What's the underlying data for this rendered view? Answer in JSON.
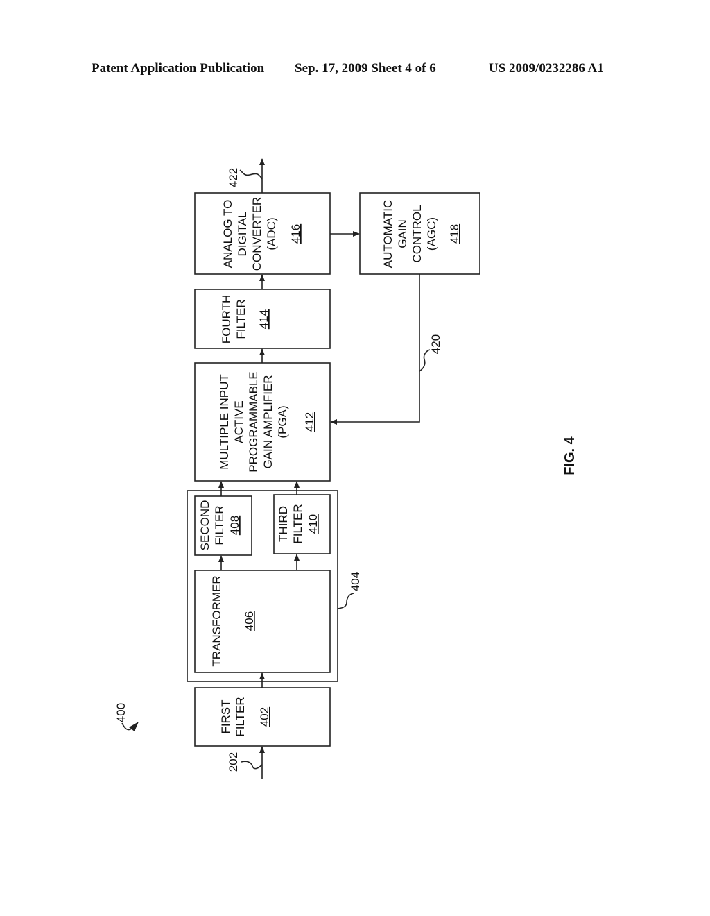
{
  "header": {
    "left": "Patent Application Publication",
    "middle": "Sep. 17, 2009   Sheet 4 of 6",
    "right": "US 2009/0232286 A1"
  },
  "figure": {
    "label": "FIG. 4",
    "system_ref": "400",
    "input_ref": "202",
    "output_ref": "422",
    "feedback_ref": "420",
    "group_ref": "404"
  },
  "blocks": {
    "first_filter": {
      "lines": [
        "FIRST",
        "FILTER"
      ],
      "ref": "402"
    },
    "transformer": {
      "lines": [
        "TRANSFORMER"
      ],
      "ref": "406"
    },
    "second_filter": {
      "lines": [
        "SECOND",
        "FILTER"
      ],
      "ref": "408"
    },
    "third_filter": {
      "lines": [
        "THIRD",
        "FILTER"
      ],
      "ref": "410"
    },
    "pga": {
      "lines": [
        "MULTIPLE INPUT",
        "ACTIVE",
        "PROGRAMMABLE",
        "GAIN AMPLIFIER",
        "(PGA)"
      ],
      "ref": "412"
    },
    "fourth_filter": {
      "lines": [
        "FOURTH",
        "FILTER"
      ],
      "ref": "414"
    },
    "adc": {
      "lines": [
        "ANALOG TO",
        "DIGITAL",
        "CONVERTER",
        "(ADC)"
      ],
      "ref": "416"
    },
    "agc": {
      "lines": [
        "AUTOMATIC",
        "GAIN",
        "CONTROL",
        "(AGC)"
      ],
      "ref": "418"
    }
  }
}
